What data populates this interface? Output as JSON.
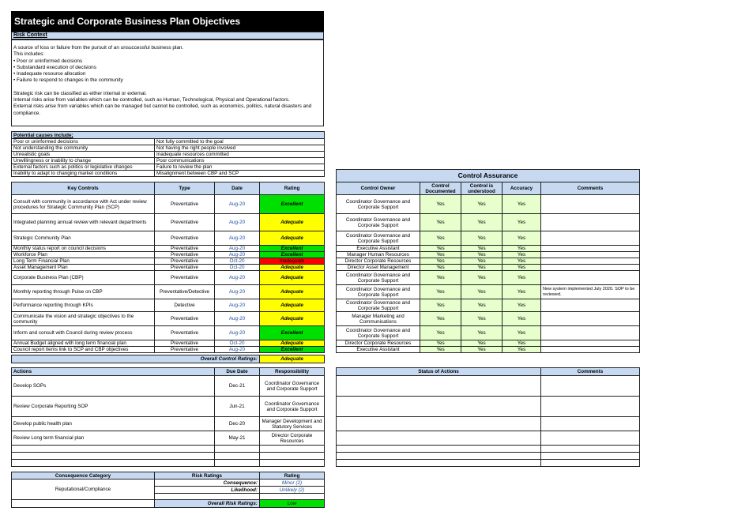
{
  "title": "Strategic and Corporate Business Plan Objectives",
  "risk_context": {
    "heading": "Risk Context",
    "intro": "A source of loss or failure from the pursuit of an unsuccessful business plan.",
    "includes": "This includes:",
    "bullets": [
      "• Poor or uninformed decisions",
      "• Substandard execution of decisions",
      "• Inadequate resource allocation",
      "• Failure to respond to changes in the community"
    ],
    "p1": "Strategic risk can be classified as either internal or external.",
    "p2": "Internal risks arise from variables which can be controlled, such as Human, Technological, Physical and Operational factors.",
    "p3": "External risks arise from variables which can be managed but cannot be controlled, such as economics, politics, natural disasters and compliance."
  },
  "causes": {
    "heading": "Potential causes include;",
    "rows": [
      [
        "Poor or uninformed decisions",
        "Not fully committed to the goal"
      ],
      [
        "Not understanding the community",
        "Not having the right people involved"
      ],
      [
        "Unrealistic goals",
        "Inadequate resources committed"
      ],
      [
        "Unwillingness or inability to change",
        "Poor communications"
      ],
      [
        "External factors such as politics or legislative changes",
        "Failure to review the plan"
      ],
      [
        "Inability to adapt to changing market conditions",
        "Misalignment between CBP and SCP"
      ]
    ]
  },
  "controls": {
    "headers": [
      "Key Controls",
      "Type",
      "Date",
      "Rating"
    ],
    "rows": [
      {
        "control": "Consult with community in accordance with Act under review procedures for Strategic Community Plan (SCP)",
        "type": "Preventative",
        "date": "Aug-20",
        "rating": "Excellent",
        "color": "#00e000"
      },
      {
        "control": "Integrated planning annual review with relevant departments",
        "type": "Preventative",
        "date": "Aug-20",
        "rating": "Adequate",
        "color": "#ffff00"
      },
      {
        "control": "Strategic Community Plan",
        "type": "Preventative",
        "date": "Aug-20",
        "rating": "Adequate",
        "color": "#ffff00"
      },
      {
        "control": "Monthly status report on council decisions",
        "type": "Preventative",
        "date": "Aug-20",
        "rating": "Excellent",
        "color": "#00e000"
      },
      {
        "control": "Workforce Plan",
        "type": "Preventative",
        "date": "Aug-20",
        "rating": "Excellent",
        "color": "#00e000"
      },
      {
        "control": "Long Term Financial Plan",
        "type": "Preventative",
        "date": "Oct-20",
        "rating": "Inadequate",
        "color": "#ff0000"
      },
      {
        "control": "Asset Management Plan",
        "type": "Preventative",
        "date": "Oct-20",
        "rating": "Adequate",
        "color": "#ffff00"
      },
      {
        "control": "Corporate Business Plan (CBP)",
        "type": "Preventative",
        "date": "Aug-20",
        "rating": "Adequate",
        "color": "#ffff00"
      },
      {
        "control": "Monthly reporting through Pulse on CBP",
        "type": "Preventative/Detective",
        "date": "Aug-20",
        "rating": "Adequate",
        "color": "#ffff00"
      },
      {
        "control": "Performance reporting through KPIs",
        "type": "Detective",
        "date": "Aug-20",
        "rating": "Adequate",
        "color": "#ffff00"
      },
      {
        "control": "Communicate the vision and strategic objectives to the community",
        "type": "Preventative",
        "date": "Aug-20",
        "rating": "Adequate",
        "color": "#ffff00"
      },
      {
        "control": "Inform and consult with Council during review process",
        "type": "Preventative",
        "date": "Aug-20",
        "rating": "Excellent",
        "color": "#00e000"
      },
      {
        "control": "Annual Budget aligned with long term financial plan",
        "type": "Preventative",
        "date": "Oct-20",
        "rating": "Adequate",
        "color": "#ffff00"
      },
      {
        "control": "Council report items link to SCP and CBP objectives",
        "type": "Preventative",
        "date": "Aug-20",
        "rating": "Excellent",
        "color": "#00e000"
      }
    ],
    "overall_label": "Overall Control Ratings:",
    "overall_value": "Adequate"
  },
  "assurance": {
    "title": "Control Assurance",
    "headers": [
      "Control Owner",
      "Control Documented",
      "Control is understood",
      "Accuracy",
      "Comments"
    ],
    "rows": [
      [
        "Coordinator Governance and Corporate Support",
        "Yes",
        "Yes",
        "Yes",
        ""
      ],
      [
        "Coordinator Governance and Corporate Support",
        "Yes",
        "Yes",
        "Yes",
        ""
      ],
      [
        "Coordinator Governance and Corporate Support",
        "Yes",
        "Yes",
        "Yes",
        ""
      ],
      [
        "Executive Assistant",
        "Yes",
        "Yes",
        "Yes",
        ""
      ],
      [
        "Manager Human Resources",
        "Yes",
        "Yes",
        "Yes",
        ""
      ],
      [
        "Director Corporate Resources",
        "Yes",
        "Yes",
        "Yes",
        ""
      ],
      [
        "Director Asset Management",
        "Yes",
        "Yes",
        "Yes",
        ""
      ],
      [
        "Coordinator Governance and Corporate Support",
        "Yes",
        "Yes",
        "Yes",
        ""
      ],
      [
        "Coordinator Governance and Corporate Support",
        "Yes",
        "Yes",
        "Yes",
        "New system implemented July 2020. SOP to be reviewed."
      ],
      [
        "Coordinator Governance and Corporate Support",
        "Yes",
        "Yes",
        "Yes",
        ""
      ],
      [
        "Manager Marketing and Communications",
        "Yes",
        "Yes",
        "Yes",
        ""
      ],
      [
        "Coordinator Governance and Corporate Support",
        "Yes",
        "Yes",
        "Yes",
        ""
      ],
      [
        "Director Corporate Resources",
        "Yes",
        "Yes",
        "Yes",
        ""
      ],
      [
        "Executive Assistant",
        "Yes",
        "Yes",
        "Yes",
        ""
      ]
    ]
  },
  "actions": {
    "headers": [
      "Actions",
      "Due Date",
      "Responsibility"
    ],
    "rows": [
      [
        "Develop SOPs",
        "Dec-21",
        "Coordinator Governance and Corporate Support"
      ],
      [
        "Review Corporate Reporting SOP",
        "Jun-21",
        "Coordinator Governance and Corporate Support"
      ],
      [
        "Develop public health plan",
        "Dec-20",
        "Manager Development and Statutory Services"
      ],
      [
        "Review Long term financial plan",
        "May-21",
        "Director Corporate Resources"
      ],
      [
        "",
        "",
        ""
      ],
      [
        "",
        "",
        ""
      ],
      [
        "",
        "",
        ""
      ]
    ]
  },
  "status": {
    "headers": [
      "Status of Actions",
      "Comments"
    ]
  },
  "risk": {
    "consequence_header": "Consequence Category",
    "ratings_header": "Risk Ratings",
    "rating_header": "Rating",
    "category": "Reputational/Compliance",
    "consequence_label": "Consequence:",
    "consequence_value": "Minor (2)",
    "likelihood_label": "Likelihood:",
    "likelihood_value": "Unlikely (2)",
    "overall_label": "Overall Risk Ratings:",
    "overall_value": "Low"
  }
}
